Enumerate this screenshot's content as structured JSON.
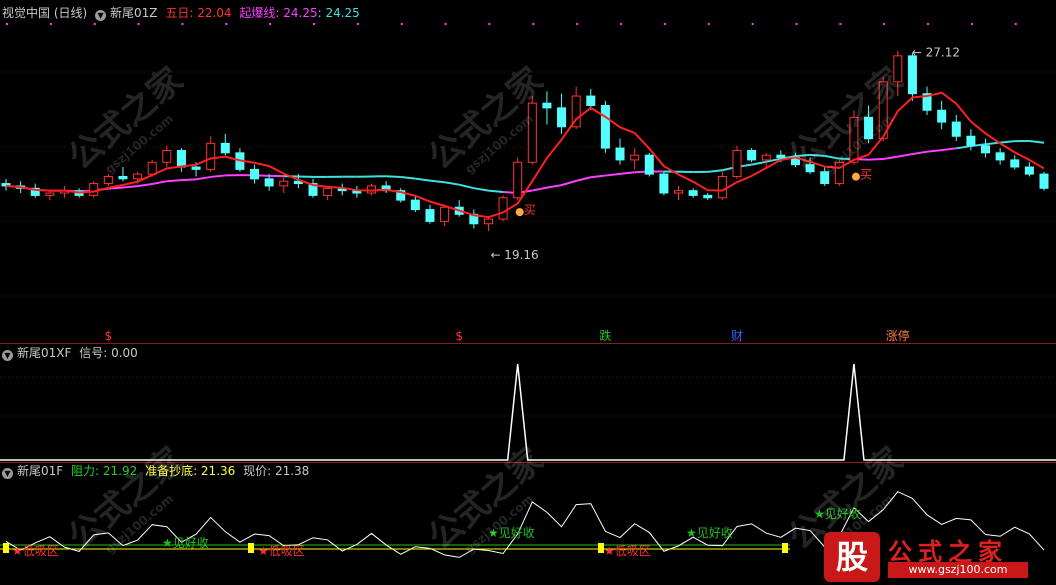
{
  "main_panel": {
    "stock_name": "视觉中国 (日线)",
    "indicator_name": "新尾01Z",
    "wuri_label": "五日: 22.04",
    "qibao_label": "起爆线: 24.25",
    "qibao_value2": ": 24.25",
    "high_label": "27.12",
    "low_label": "19.16",
    "buy_label": "买",
    "markers": [
      "$",
      "$",
      "跌",
      "财",
      "涨停"
    ]
  },
  "xf_panel": {
    "indicator_name": "新尾01XF",
    "signal_label": "信号: 0.00"
  },
  "f_panel": {
    "indicator_name": "新尾01F",
    "resistance_label": "阻力: 21.92",
    "support_label": "准备抄底: 21.36",
    "price_label": "现价: 21.38",
    "zone_low": "低吸区",
    "zone_good": "见好收"
  },
  "watermark": {
    "text": "公式之家",
    "url": "gszj100.com"
  },
  "logo": {
    "char": "股",
    "name": "公式之家",
    "url": "www.gszj100.com"
  },
  "colors": {
    "up": "#ff3232",
    "down": "#54ffff",
    "ma5": "#ff2020",
    "line": "#ff40ff",
    "line_alt": "#40e0e0",
    "signal": "#ffffff",
    "yellow": "#ffff00",
    "green": "#20c020"
  },
  "chart_data": {
    "type": "candlestick",
    "price_range": [
      17.0,
      28.5
    ],
    "high": 27.12,
    "low": 19.16,
    "ohlc": [
      [
        21.5,
        21.7,
        21.2,
        21.4
      ],
      [
        21.4,
        21.6,
        21.1,
        21.3
      ],
      [
        21.3,
        21.5,
        20.9,
        21.0
      ],
      [
        21.0,
        21.2,
        20.8,
        21.1
      ],
      [
        21.1,
        21.4,
        20.9,
        21.2
      ],
      [
        21.2,
        21.3,
        20.9,
        21.0
      ],
      [
        21.0,
        21.6,
        20.9,
        21.5
      ],
      [
        21.5,
        21.9,
        21.4,
        21.8
      ],
      [
        21.8,
        22.2,
        21.6,
        21.7
      ],
      [
        21.7,
        22.0,
        21.5,
        21.9
      ],
      [
        21.9,
        22.5,
        21.8,
        22.4
      ],
      [
        22.4,
        23.1,
        22.2,
        22.9
      ],
      [
        22.9,
        23.0,
        22.0,
        22.2
      ],
      [
        22.2,
        22.4,
        21.8,
        22.1
      ],
      [
        22.1,
        23.5,
        22.0,
        23.2
      ],
      [
        23.2,
        23.6,
        22.7,
        22.8
      ],
      [
        22.8,
        23.0,
        22.0,
        22.1
      ],
      [
        22.1,
        22.3,
        21.5,
        21.7
      ],
      [
        21.7,
        21.9,
        21.2,
        21.4
      ],
      [
        21.4,
        21.8,
        21.1,
        21.6
      ],
      [
        21.6,
        21.9,
        21.3,
        21.5
      ],
      [
        21.5,
        21.7,
        20.9,
        21.0
      ],
      [
        21.0,
        21.4,
        20.8,
        21.3
      ],
      [
        21.3,
        21.5,
        21.0,
        21.2
      ],
      [
        21.2,
        21.4,
        20.9,
        21.1
      ],
      [
        21.1,
        21.5,
        21.0,
        21.4
      ],
      [
        21.4,
        21.6,
        21.1,
        21.2
      ],
      [
        21.2,
        21.3,
        20.7,
        20.8
      ],
      [
        20.8,
        21.0,
        20.3,
        20.4
      ],
      [
        20.4,
        20.6,
        19.8,
        19.9
      ],
      [
        19.9,
        20.6,
        19.7,
        20.5
      ],
      [
        20.5,
        20.8,
        20.1,
        20.2
      ],
      [
        20.2,
        20.4,
        19.6,
        19.8
      ],
      [
        19.8,
        20.1,
        19.5,
        20.0
      ],
      [
        20.0,
        21.0,
        19.9,
        20.9
      ],
      [
        20.9,
        22.6,
        20.8,
        22.4
      ],
      [
        22.4,
        25.2,
        22.3,
        24.9
      ],
      [
        24.9,
        25.4,
        24.0,
        24.7
      ],
      [
        24.7,
        25.3,
        23.6,
        23.9
      ],
      [
        23.9,
        25.6,
        23.8,
        25.2
      ],
      [
        25.2,
        25.5,
        24.6,
        24.8
      ],
      [
        24.8,
        25.0,
        22.8,
        23.0
      ],
      [
        23.0,
        23.4,
        22.3,
        22.5
      ],
      [
        22.5,
        23.0,
        22.1,
        22.7
      ],
      [
        22.7,
        22.8,
        21.8,
        21.9
      ],
      [
        21.9,
        22.0,
        21.0,
        21.1
      ],
      [
        21.1,
        21.4,
        20.8,
        21.2
      ],
      [
        21.2,
        21.3,
        20.9,
        21.0
      ],
      [
        21.0,
        21.1,
        20.8,
        20.9
      ],
      [
        20.9,
        22.0,
        20.8,
        21.8
      ],
      [
        21.8,
        23.1,
        21.7,
        22.9
      ],
      [
        22.9,
        23.0,
        22.4,
        22.5
      ],
      [
        22.5,
        22.8,
        22.2,
        22.7
      ],
      [
        22.7,
        22.9,
        22.4,
        22.6
      ],
      [
        22.6,
        22.8,
        22.2,
        22.3
      ],
      [
        22.3,
        22.6,
        21.9,
        22.0
      ],
      [
        22.0,
        22.2,
        21.4,
        21.5
      ],
      [
        21.5,
        22.5,
        21.4,
        22.4
      ],
      [
        22.4,
        24.6,
        22.3,
        24.3
      ],
      [
        24.3,
        24.8,
        23.2,
        23.4
      ],
      [
        23.4,
        26.0,
        23.3,
        25.8
      ],
      [
        25.8,
        27.12,
        25.2,
        26.9
      ],
      [
        26.9,
        27.0,
        25.0,
        25.3
      ],
      [
        25.3,
        25.6,
        24.4,
        24.6
      ],
      [
        24.6,
        25.0,
        23.8,
        24.1
      ],
      [
        24.1,
        24.4,
        23.3,
        23.5
      ],
      [
        23.5,
        23.8,
        22.9,
        23.1
      ],
      [
        23.1,
        23.4,
        22.6,
        22.8
      ],
      [
        22.8,
        23.0,
        22.3,
        22.5
      ],
      [
        22.5,
        22.7,
        22.1,
        22.2
      ],
      [
        22.2,
        22.4,
        21.8,
        21.9
      ],
      [
        21.9,
        22.0,
        21.2,
        21.3
      ]
    ]
  }
}
